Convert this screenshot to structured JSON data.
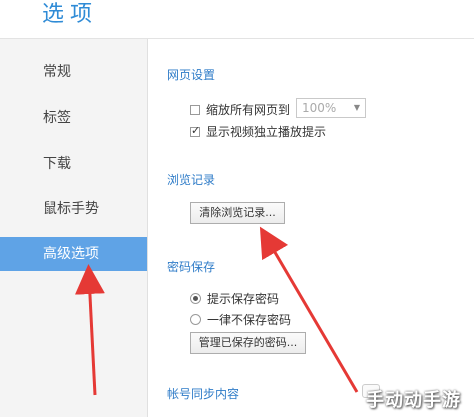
{
  "header": {
    "title": "选项"
  },
  "sidebar": {
    "items": [
      {
        "label": "常规"
      },
      {
        "label": "标签"
      },
      {
        "label": "下载"
      },
      {
        "label": "鼠标手势"
      },
      {
        "label": "高级选项",
        "active": true
      }
    ]
  },
  "webpage_settings": {
    "title": "网页设置",
    "zoom_all": {
      "label": "缩放所有网页到",
      "checked": false
    },
    "zoom_select": {
      "value": "100%"
    },
    "show_video_hint": {
      "label": "显示视频独立播放提示",
      "checked": true
    }
  },
  "browsing_history": {
    "title": "浏览记录",
    "clear_button": "清除浏览记录..."
  },
  "password_save": {
    "title": "密码保存",
    "options": [
      {
        "label": "提示保存密码",
        "selected": true
      },
      {
        "label": "一律不保存密码",
        "selected": false
      }
    ],
    "manage_button": "管理已保存的密码..."
  },
  "account_sync": {
    "title": "帐号同步内容"
  },
  "watermark": {
    "text": "手动动手游"
  },
  "colors": {
    "accent": "#2f8bd6",
    "active_nav": "#5fa3e6",
    "arrow": "#e53935"
  }
}
